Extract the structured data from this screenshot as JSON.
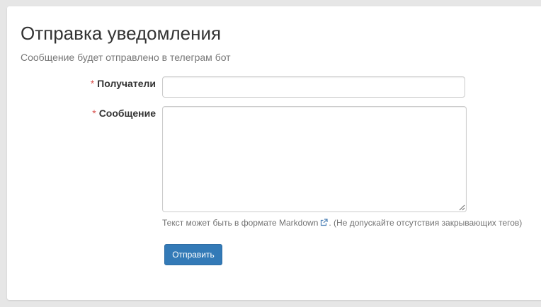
{
  "form": {
    "title": "Отправка уведомления",
    "subtitle": "Сообщение будет отправлено в телеграм бот",
    "required_mark": "*",
    "recipients": {
      "label": "Получатели",
      "value": "",
      "placeholder": ""
    },
    "message": {
      "label": "Сообщение",
      "value": "",
      "placeholder": ""
    },
    "help": {
      "prefix": "Текст может быть в формате",
      "link": "Markdown",
      "link_icon": "external-link-icon",
      "suffix": ". (Не допускайте отсутствия закрывающих тегов)"
    },
    "submit_label": "Отправить"
  },
  "colors": {
    "primary": "#337ab7",
    "required": "#d9534f",
    "muted": "#777777"
  }
}
